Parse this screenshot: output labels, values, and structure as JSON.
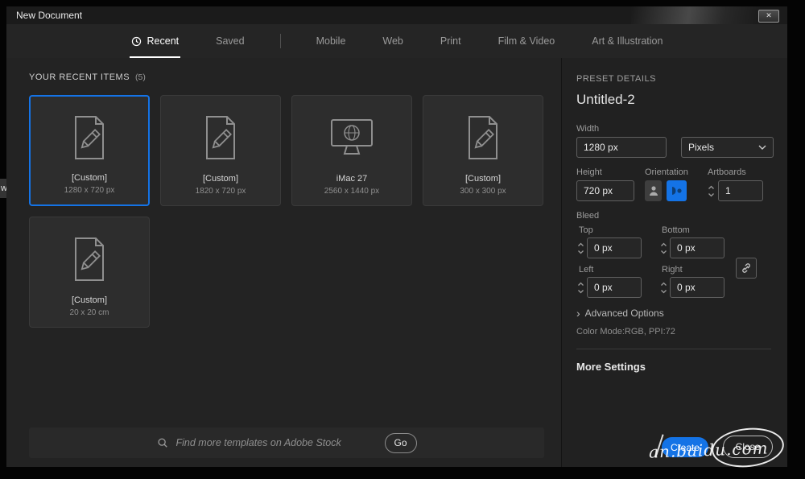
{
  "window": {
    "title": "New Document"
  },
  "icons": {
    "close": "✕",
    "advanced": "›"
  },
  "tabs": [
    {
      "label": "Recent",
      "active": true
    },
    {
      "label": "Saved"
    },
    {
      "label": "Mobile"
    },
    {
      "label": "Web"
    },
    {
      "label": "Print"
    },
    {
      "label": "Film & Video"
    },
    {
      "label": "Art & Illustration"
    }
  ],
  "recent": {
    "heading": "YOUR RECENT ITEMS",
    "count": "(5)",
    "items": [
      {
        "name": "[Custom]",
        "size": "1280 x 720 px",
        "icon": "document-pencil-icon",
        "selected": true
      },
      {
        "name": "[Custom]",
        "size": "1820 x 720 px",
        "icon": "document-pencil-icon",
        "selected": false
      },
      {
        "name": "iMac 27",
        "size": "2560 x 1440 px",
        "icon": "imac-globe-icon",
        "selected": false
      },
      {
        "name": "[Custom]",
        "size": "300 x 300 px",
        "icon": "document-pencil-icon",
        "selected": false
      },
      {
        "name": "[Custom]",
        "size": "20 x 20 cm",
        "icon": "document-pencil-icon",
        "selected": false
      }
    ]
  },
  "search": {
    "placeholder": "Find more templates on Adobe Stock",
    "go_label": "Go"
  },
  "preset": {
    "heading": "PRESET DETAILS",
    "name": "Untitled-2",
    "width_label": "Width",
    "width_value": "1280 px",
    "units_value": "Pixels",
    "height_label": "Height",
    "height_value": "720 px",
    "orientation_label": "Orientation",
    "artboards_label": "Artboards",
    "artboards_value": "1",
    "bleed_label": "Bleed",
    "bleed_top_label": "Top",
    "bleed_top_value": "0 px",
    "bleed_bottom_label": "Bottom",
    "bleed_bottom_value": "0 px",
    "bleed_left_label": "Left",
    "bleed_left_value": "0 px",
    "bleed_right_label": "Right",
    "bleed_right_value": "0 px",
    "advanced_label": "Advanced Options",
    "color_mode": "Color Mode:RGB, PPI:72",
    "more_settings_label": "More Settings",
    "create_label": "Create",
    "close_label": "Close"
  },
  "watermark": {
    "text": "an.baidu.com"
  },
  "background": {
    "fragment": "w"
  },
  "colors": {
    "accent": "#1473e6",
    "dialog_bg": "#232323",
    "panel_bg": "#212121"
  }
}
